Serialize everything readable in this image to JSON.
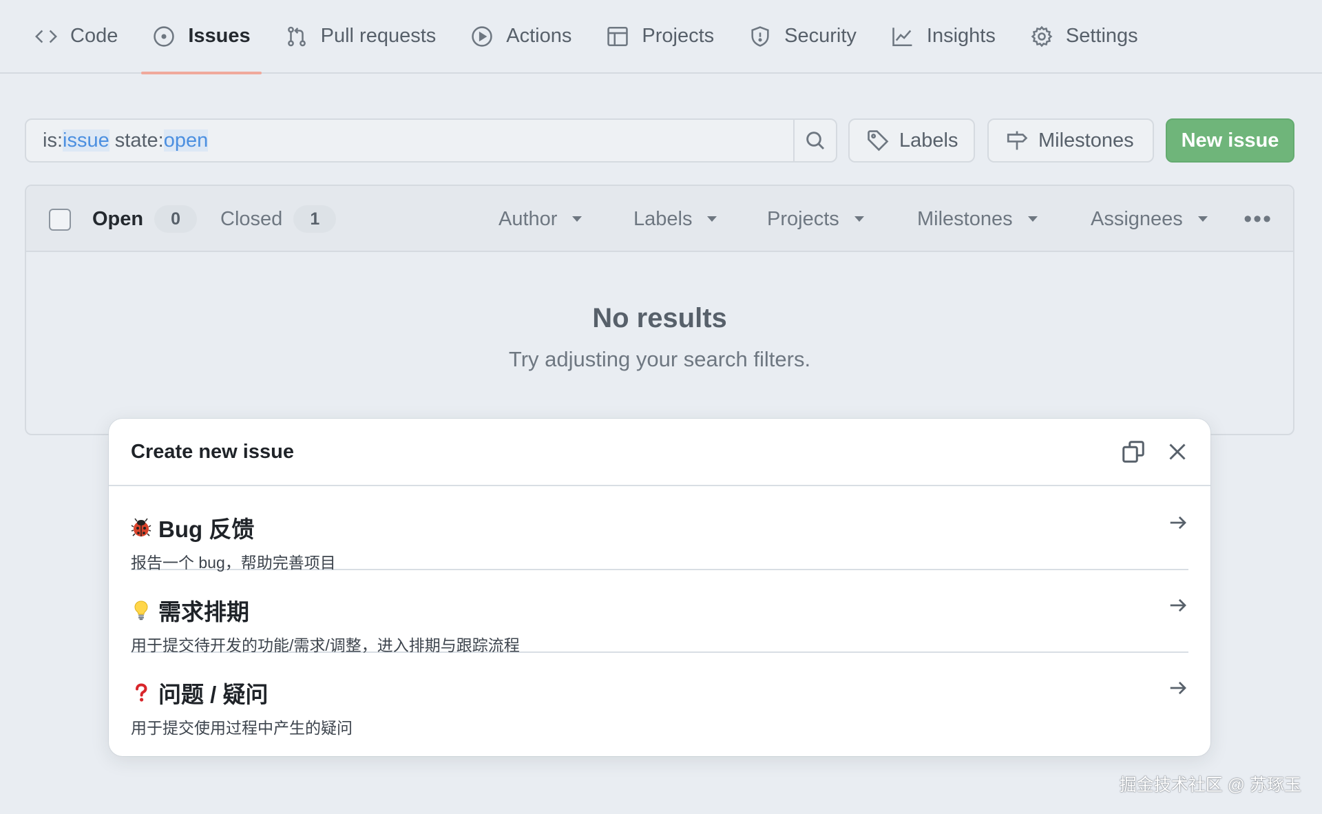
{
  "nav": {
    "tabs": [
      {
        "label": "Code",
        "icon": "code-icon"
      },
      {
        "label": "Issues",
        "icon": "issue-opened-icon"
      },
      {
        "label": "Pull requests",
        "icon": "git-pull-request-icon"
      },
      {
        "label": "Actions",
        "icon": "play-icon"
      },
      {
        "label": "Projects",
        "icon": "table-icon"
      },
      {
        "label": "Security",
        "icon": "shield-icon"
      },
      {
        "label": "Insights",
        "icon": "graph-icon"
      },
      {
        "label": "Settings",
        "icon": "gear-icon"
      }
    ],
    "active_tab": "Issues",
    "active_underline_color": "#f0a99c"
  },
  "search": {
    "segments": [
      {
        "text": "is:",
        "highlight": false
      },
      {
        "text": "issue",
        "highlight": true
      },
      {
        "text": " state:",
        "highlight": false
      },
      {
        "text": "open",
        "highlight": true
      }
    ],
    "search_icon": "search-icon"
  },
  "toolbar": {
    "labels_label": "Labels",
    "milestones_label": "Milestones",
    "new_issue_label": "New issue",
    "new_issue_color": "#6fb57a"
  },
  "list": {
    "open_label": "Open",
    "open_count": "0",
    "closed_label": "Closed",
    "closed_count": "1",
    "filters": [
      "Author",
      "Labels",
      "Projects",
      "Milestones",
      "Assignees"
    ],
    "empty_title": "No results",
    "empty_subtitle": "Try adjusting your search filters."
  },
  "modal": {
    "title": "Create new issue",
    "templates": [
      {
        "emoji": "🐞",
        "title": "Bug 反馈",
        "description": "报告一个 bug，帮助完善项目"
      },
      {
        "emoji": "💡",
        "title": "需求排期",
        "description": "用于提交待开发的功能/需求/调整，进入排期与跟踪流程"
      },
      {
        "emoji": "❓",
        "title": "问题 / 疑问",
        "description": "用于提交使用过程中产生的疑问"
      }
    ]
  },
  "watermark": "掘金技术社区 @ 苏琢玉"
}
